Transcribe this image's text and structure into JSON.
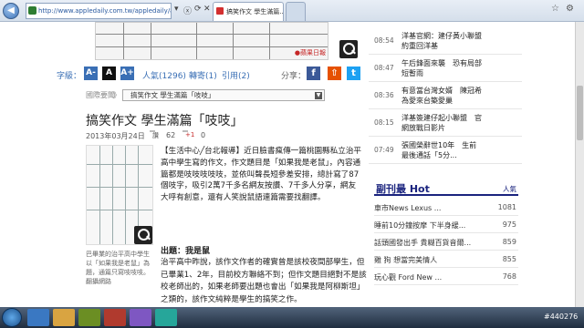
{
  "browser": {
    "address": "http://www.appledaily.com.tw/appledaily/article/he...",
    "tabs": [
      {
        "label": "搞笑作文 學生滿篇...",
        "active": true
      },
      {
        "label": "",
        "active": false
      }
    ],
    "addr_controls": [
      "▾",
      "ⓧ",
      "⟳",
      "✕"
    ],
    "window_controls": [
      "☆",
      "⚙"
    ],
    "back": "◀",
    "forward": "▶"
  },
  "article_toolbar": {
    "font_label": "字級：",
    "font_sizes": [
      "A-",
      "A",
      "A+"
    ],
    "views": "人氣(1296)",
    "forwards": "轉寄(1)",
    "quotes": "引用(2)",
    "share_label": "分享：",
    "share_icons": [
      "f",
      "⇧",
      "t"
    ]
  },
  "breadcrumb": {
    "section": "國際要聞",
    "separator": "》",
    "selected": "搞笑作文 學生滿篇「吱吱」"
  },
  "article": {
    "title": "搞笑作文 學生滿篇「吱吱」",
    "date": "2013年03月24日",
    "like_label": "讚",
    "like_count": "62",
    "plus_label": "+1",
    "plus_count": "0",
    "caption": "巴畢業的治平高中學生以「如果我是老鼠」為題，通篇只寫吱吱吱。翻攝網路",
    "body1": "【生活中心╱台北報導】近日臉書瘋傳一篇桃園縣私立治平高中學生寫的作文，作文題目是「如果我是老鼠」，內容通篇都是吱吱吱吱吱，並依叫聲長短參差安排，總計寫了87個吱字，吸引2萬7千多名網友按讚、7千多人分享，網友大呼有創意，還有人笑說鼠語連篇需要找翻譯。",
    "subhead": "出題：我是鼠",
    "body2": "治平高中昨說，該作文作者的確實曾是該校夜間部學生，但已畢業1、2年，目前校方聯絡不到；但作文題目絕對不是該校老師出的，如果老師要出題也會出「如果我是阿柳斯坦」之類的，該作文純粹是學生的搞笑之作。"
  },
  "sidebar": {
    "news": [
      {
        "time": "08:54",
        "title": "洋基官網：建仔黃小聯盟約重回洋基"
      },
      {
        "time": "08:47",
        "title": "午后鋒面來襲　恐有局部短暫雨"
      },
      {
        "time": "08:36",
        "title": "有意當台灣女婿　陳冠希為愛來台築愛巢"
      },
      {
        "time": "08:15",
        "title": "洋基簽建仔起小聯盟　官網放戰日影片"
      },
      {
        "time": "07:49",
        "title": "張國榮辭世10年　生前最後通話「5分..."
      }
    ],
    "hot_title": "副刊最 Hot",
    "hot_more": "人氣",
    "hot": [
      {
        "title": "車市News Lexus ...",
        "count": "1081"
      },
      {
        "title": "睡前10分鐘按摩 下半身緩...",
        "count": "975"
      },
      {
        "title": "話頭國發出手 貴糊百貨音爾...",
        "count": "859"
      },
      {
        "title": "雞 狗 想當完美情人",
        "count": "855"
      },
      {
        "title": "玩心觀 Ford New ...",
        "count": "768"
      }
    ]
  },
  "taskbar": {
    "tray_text": "#440276"
  },
  "colors": {
    "facebook": "#3b5998",
    "twitter": "#1da1f2",
    "rss": "#e65100",
    "hot_accent": "#1a237e"
  }
}
